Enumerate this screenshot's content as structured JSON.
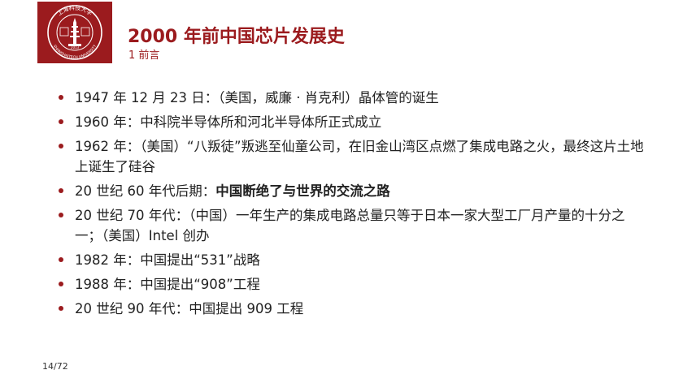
{
  "slide": {
    "logo": {
      "icon": "university-seal-icon",
      "top_text": "上海科技大学",
      "bottom_text": "SHANGHAITECH UNIVERSITY",
      "year": "2013",
      "inner_text": "立志 成才 报国 裕民",
      "color": "#9b1b1e"
    },
    "title": "2000 年前中国芯片发展史",
    "subtitle": "1 前言",
    "accent_color": "#9b1b1e",
    "bullets": [
      {
        "text": "1947 年 12 月 23 日：（美国，威廉 · 肖克利）晶体管的诞生"
      },
      {
        "text": "1960 年：中科院半导体所和河北半导体所正式成立"
      },
      {
        "text": "1962 年：（美国）“八叛徒”叛逃至仙童公司，在旧金山湾区点燃了集成电路之火，最终这片土地上诞生了硅谷"
      },
      {
        "prefix": "20 世纪 60 年代后期：",
        "emphasis": "中国断绝了与世界的交流之路"
      },
      {
        "text": "20 世纪 70 年代：（中国）一年生产的集成电路总量只等于日本一家大型工厂月产量的十分之一；（美国）Intel 创办"
      },
      {
        "text": "1982 年：中国提出“531”战略"
      },
      {
        "text": "1988 年：中国提出“908”工程"
      },
      {
        "text": "20 世纪 90 年代：中国提出 909 工程"
      }
    ],
    "page_number": "14/72"
  }
}
